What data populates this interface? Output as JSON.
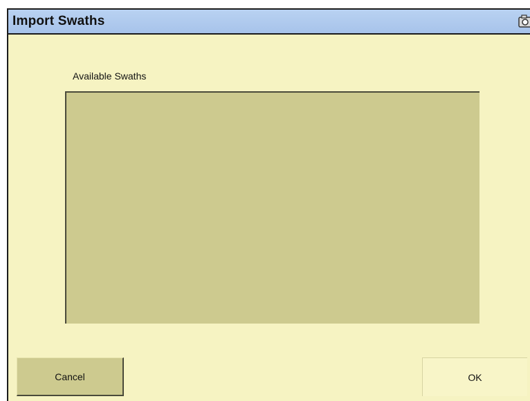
{
  "window": {
    "title": "Import Swaths",
    "title_icon": "camera-icon"
  },
  "list": {
    "label": "Available Swaths",
    "items": []
  },
  "buttons": {
    "cancel_label": "Cancel",
    "ok_label": "OK"
  },
  "colors": {
    "titlebar": "#a7c3ea",
    "background": "#f6f3c2",
    "list_background": "#cdca8f",
    "cancel_button": "#cdca8f"
  }
}
